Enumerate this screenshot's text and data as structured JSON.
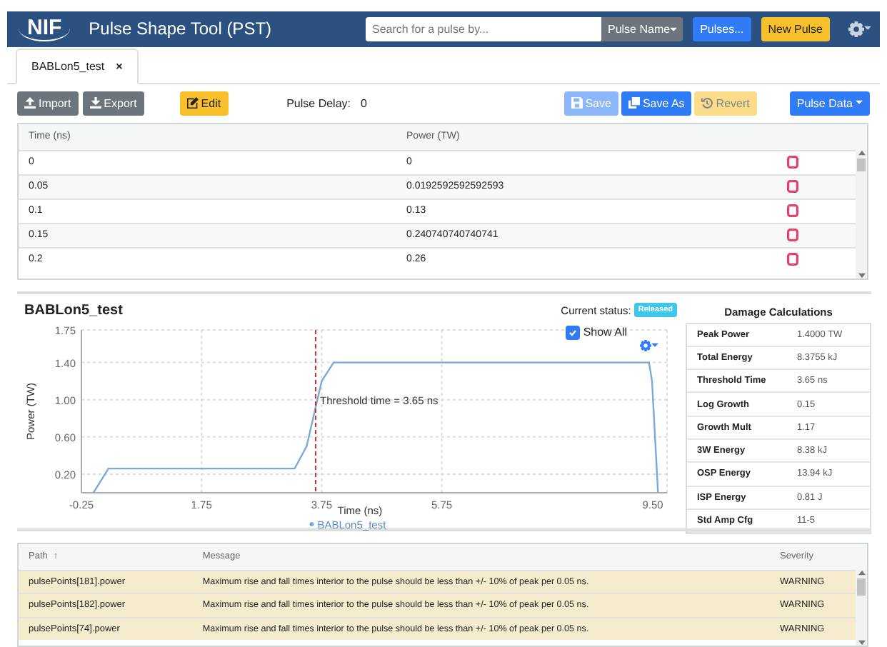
{
  "header": {
    "logo": "NIF",
    "title": "Pulse Shape Tool (PST)",
    "search": {
      "placeholder": "Search for a pulse by..."
    },
    "search_mode": "Pulse Name",
    "buttons": [
      {
        "label": "Pulses...",
        "kind": "primary"
      },
      {
        "label": "New Pulse",
        "kind": "warning"
      }
    ]
  },
  "tabs": [
    {
      "label": "BABLon5_test",
      "selected": true,
      "close": "×"
    }
  ],
  "toolbar": {
    "buttons": [
      {
        "label": "Import",
        "kind": "secondary",
        "disabled": false
      },
      {
        "label": "Export",
        "kind": "secondary",
        "disabled": false
      },
      {
        "label": "Edit",
        "kind": "warning",
        "disabled": false
      }
    ],
    "pulse_delay": {
      "label": "Pulse Delay:",
      "value": "0"
    },
    "right_buttons": [
      {
        "label": "Save",
        "kind": "primary",
        "disabled": true
      },
      {
        "label": "Save As",
        "kind": "primary",
        "disabled": false
      },
      {
        "label": "Revert",
        "kind": "warning",
        "disabled": true
      },
      {
        "label": "Pulse Data",
        "kind": "primary",
        "disabled": false
      }
    ]
  },
  "points_table": {
    "columns": [
      "Time (ns)",
      "Power (TW)"
    ],
    "rows": [
      {
        "time": "0",
        "power": "0"
      },
      {
        "time": "0.05",
        "power": "0.0192592592592593"
      },
      {
        "time": "0.1",
        "power": "0.13"
      },
      {
        "time": "0.15",
        "power": "0.240740740740741"
      },
      {
        "time": "0.2",
        "power": "0.26"
      }
    ]
  },
  "pulse": {
    "title": "BABLon5_test",
    "status_label": "Current status:",
    "status": "Released",
    "show_all": {
      "label": "Show All",
      "checked": true
    },
    "chart_data": {
      "type": "line",
      "xlabel": "Time (ns)",
      "ylabel": "Power (TW)",
      "xlim": [
        -0.25,
        9.5
      ],
      "ylim": [
        0,
        1.75
      ],
      "grid": true,
      "xticks": [
        -0.25,
        1.75,
        3.75,
        5.75,
        {
          "value": 9.5,
          "label": "9.50"
        }
      ],
      "yticks": [
        {
          "value": 0.2,
          "label": "0.20"
        },
        {
          "value": 0.6,
          "label": "0.60"
        },
        {
          "value": 1.0,
          "label": "1.00"
        },
        {
          "value": 1.4,
          "label": "1.40"
        },
        1.75
      ],
      "x": [
        -0.05,
        0.2,
        3.3,
        3.5,
        3.75,
        3.95,
        9.2,
        9.25,
        9.35
      ],
      "series": [
        {
          "name": "BABLon5_test",
          "color": "#7aaad6",
          "values": [
            0,
            0.26,
            0.26,
            0.5,
            1.2,
            1.4,
            1.4,
            1.2,
            0
          ]
        }
      ],
      "ref_lines": [
        {
          "axis": "x",
          "value": 3.65,
          "label": "Threshold time = 3.65 ns",
          "color": "#d03030"
        }
      ]
    }
  },
  "damage": {
    "title": "Damage Calculations",
    "rows": [
      {
        "label": "Peak Power",
        "value": "1.4000 TW"
      },
      {
        "label": "Total Energy",
        "value": "8.3755 kJ"
      },
      {
        "label": "Threshold Time",
        "value": "3.65 ns"
      },
      {
        "label": "Log Growth",
        "value": "0.15"
      },
      {
        "label": "Growth Mult",
        "value": "1.17"
      },
      {
        "label": "3W Energy",
        "value": "8.38 kJ"
      },
      {
        "label": "OSP Energy",
        "value": "13.94 kJ"
      },
      {
        "label": "ISP Energy",
        "value": "0.81 J"
      },
      {
        "label": "Std Amp Cfg",
        "value": "11-5"
      }
    ]
  },
  "messages": {
    "columns": [
      {
        "label": "Path",
        "sort_mark": "↑"
      },
      {
        "label": "Message"
      },
      {
        "label": "Severity"
      }
    ],
    "rows": [
      {
        "path": "pulsePoints[181].power",
        "message": "Maximum rise and fall times interior to the pulse should be less than +/- 10% of peak per 0.05 ns.",
        "severity": "WARNING"
      },
      {
        "path": "pulsePoints[182].power",
        "message": "Maximum rise and fall times interior to the pulse should be less than +/- 10% of peak per 0.05 ns.",
        "severity": "WARNING"
      },
      {
        "path": "pulsePoints[74].power",
        "message": "Maximum rise and fall times interior to the pulse should be less than +/- 10% of peak per 0.05 ns.",
        "severity": "WARNING"
      }
    ]
  }
}
